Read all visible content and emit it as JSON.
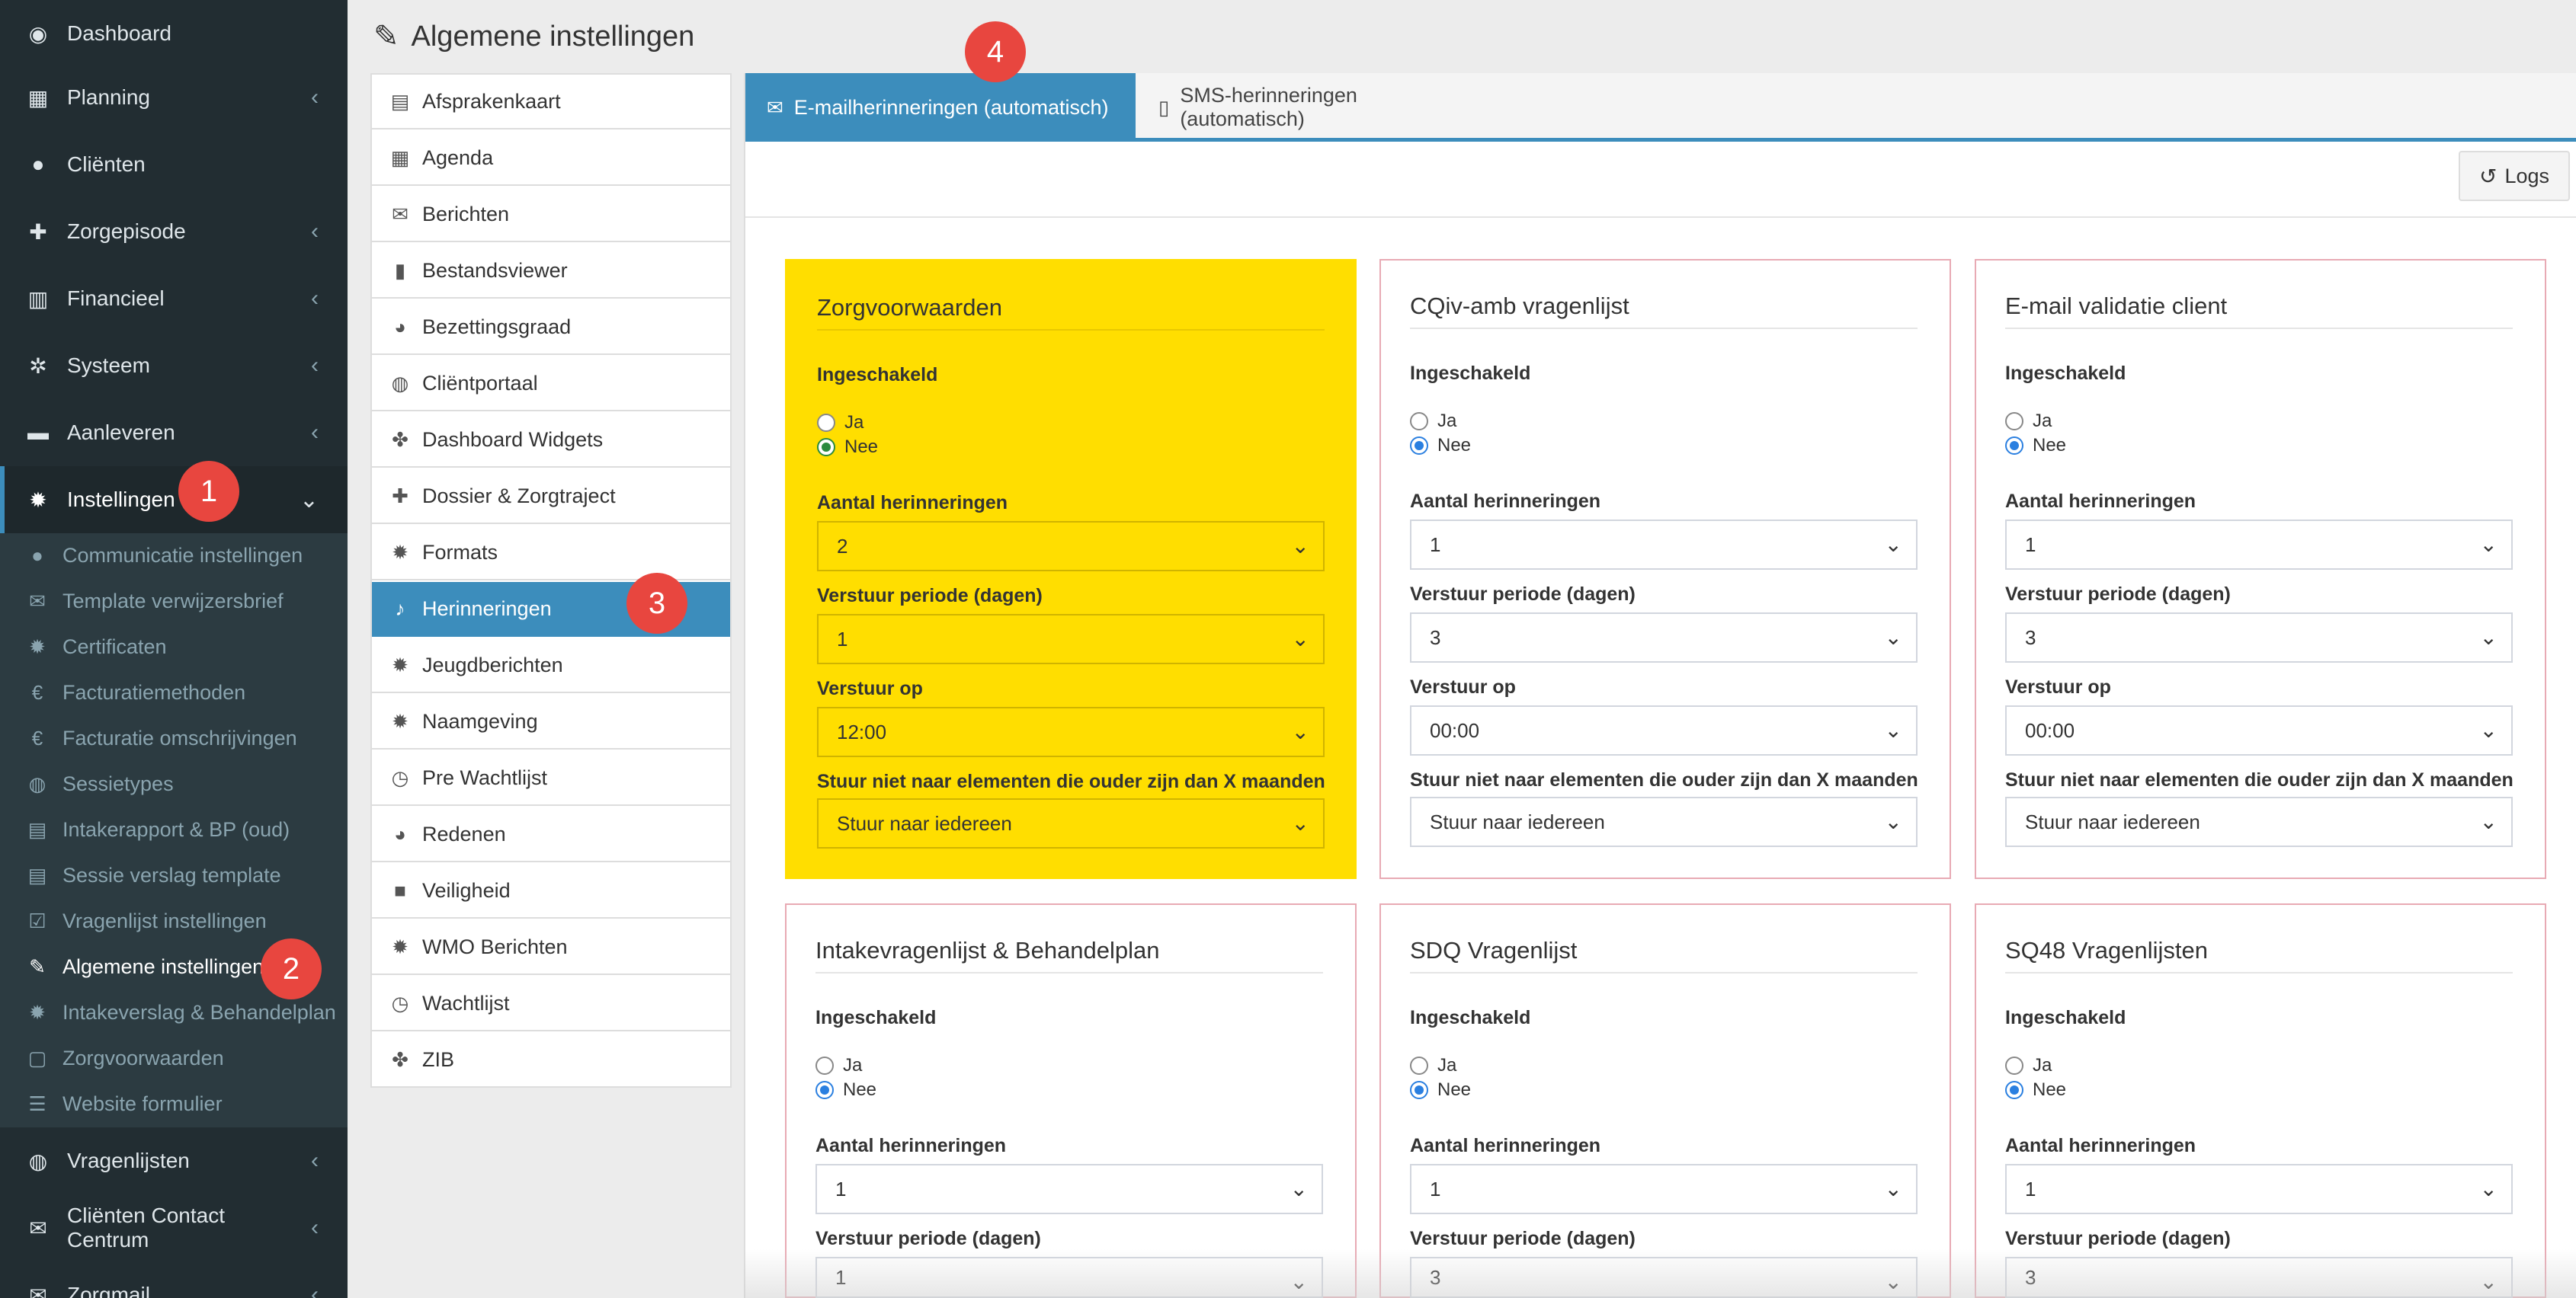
{
  "sidebar": {
    "items": [
      {
        "label": "Dashboard",
        "icon": "dashboard-icon",
        "glyph": "◉",
        "chevron": false
      },
      {
        "label": "Planning",
        "icon": "calendar-icon",
        "glyph": "▦",
        "chevron": true
      },
      {
        "label": "Cliënten",
        "icon": "user-icon",
        "glyph": "●",
        "chevron": false
      },
      {
        "label": "Zorgepisode",
        "icon": "medkit-icon",
        "glyph": "✚",
        "chevron": true
      },
      {
        "label": "Financieel",
        "icon": "book-icon",
        "glyph": "▥",
        "chevron": true
      },
      {
        "label": "Systeem",
        "icon": "cogs-icon",
        "glyph": "✲",
        "chevron": true
      },
      {
        "label": "Aanleveren",
        "icon": "truck-icon",
        "glyph": "▬",
        "chevron": true
      },
      {
        "label": "Instellingen",
        "icon": "gear-icon",
        "glyph": "✹",
        "chevron": true,
        "active": true
      }
    ],
    "subitems": [
      {
        "label": "Communicatie instellingen",
        "icon": "comments-icon",
        "glyph": "●"
      },
      {
        "label": "Template verwijzersbrief",
        "icon": "envelope-icon",
        "glyph": "✉"
      },
      {
        "label": "Certificaten",
        "icon": "certificate-icon",
        "glyph": "✹"
      },
      {
        "label": "Facturatiemethoden",
        "icon": "euro-icon",
        "glyph": "€"
      },
      {
        "label": "Facturatie omschrijvingen",
        "icon": "euro-icon",
        "glyph": "€"
      },
      {
        "label": "Sessietypes",
        "icon": "globe-icon",
        "glyph": "◍"
      },
      {
        "label": "Intakerapport & BP (oud)",
        "icon": "file-text-icon",
        "glyph": "▤"
      },
      {
        "label": "Sessie verslag template",
        "icon": "file-text-icon",
        "glyph": "▤"
      },
      {
        "label": "Vragenlijst instellingen",
        "icon": "check-square-icon",
        "glyph": "☑"
      },
      {
        "label": "Algemene instellingen",
        "icon": "wrench-icon",
        "glyph": "✎",
        "current": true
      },
      {
        "label": "Intakeverslag & Behandelplan",
        "icon": "gear-icon",
        "glyph": "✹"
      },
      {
        "label": "Zorgvoorwaarden",
        "icon": "file-pdf-icon",
        "glyph": "▢"
      },
      {
        "label": "Website formulier",
        "icon": "list-icon",
        "glyph": "☰"
      }
    ],
    "bottom_items": [
      {
        "label": "Vragenlijsten",
        "icon": "globe-icon",
        "glyph": "◍",
        "chevron": true
      },
      {
        "label": "Cliënten Contact Centrum",
        "icon": "envelope-icon",
        "glyph": "✉",
        "chevron": true
      },
      {
        "label": "Zorgmail",
        "icon": "envelope-icon",
        "glyph": "✉",
        "chevron": true
      }
    ]
  },
  "header": {
    "title": "Algemene instellingen",
    "icon": "wrench-icon",
    "glyph": "✎"
  },
  "settings_menu": {
    "items": [
      {
        "label": "Afsprakenkaart",
        "icon": "list-alt-icon",
        "glyph": "▤"
      },
      {
        "label": "Agenda",
        "icon": "calendar-icon",
        "glyph": "▦"
      },
      {
        "label": "Berichten",
        "icon": "envelope-icon",
        "glyph": "✉"
      },
      {
        "label": "Bestandsviewer",
        "icon": "file-icon",
        "glyph": "▮"
      },
      {
        "label": "Bezettingsgraad",
        "icon": "pie-chart-icon",
        "glyph": "◕"
      },
      {
        "label": "Cliëntportaal",
        "icon": "globe-icon",
        "glyph": "◍"
      },
      {
        "label": "Dashboard Widgets",
        "icon": "puzzle-icon",
        "glyph": "✤"
      },
      {
        "label": "Dossier & Zorgtraject",
        "icon": "medkit-icon",
        "glyph": "✚"
      },
      {
        "label": "Formats",
        "icon": "gear-icon",
        "glyph": "✹"
      },
      {
        "label": "Herinneringen",
        "icon": "bell-icon",
        "glyph": "♪",
        "active": true
      },
      {
        "label": "Jeugdberichten",
        "icon": "gear-icon",
        "glyph": "✹"
      },
      {
        "label": "Naamgeving",
        "icon": "gear-icon",
        "glyph": "✹"
      },
      {
        "label": "Pre Wachtlijst",
        "icon": "clock-icon",
        "glyph": "◷"
      },
      {
        "label": "Redenen",
        "icon": "pie-chart-icon",
        "glyph": "◕"
      },
      {
        "label": "Veiligheid",
        "icon": "lock-icon",
        "glyph": "■"
      },
      {
        "label": "WMO Berichten",
        "icon": "gear-icon",
        "glyph": "✹"
      },
      {
        "label": "Wachtlijst",
        "icon": "clock-icon",
        "glyph": "◷"
      },
      {
        "label": "ZIB",
        "icon": "puzzle-icon",
        "glyph": "✤"
      }
    ]
  },
  "tabs": [
    {
      "label": "E-mailherinneringen (automatisch)",
      "icon": "envelope-icon",
      "glyph": "✉",
      "active": true
    },
    {
      "label": "SMS-herinneringen (automatisch)",
      "icon": "mobile-icon",
      "glyph": "▯",
      "active": false
    }
  ],
  "logs_button": {
    "label": "Logs",
    "icon": "history-icon",
    "glyph": "↺"
  },
  "form_labels": {
    "enabled": "Ingeschakeld",
    "yes": "Ja",
    "no": "Nee",
    "count": "Aantal herinneringen",
    "period": "Verstuur periode (dagen)",
    "send_at": "Verstuur op",
    "age_filter": "Stuur niet naar elementen die ouder zijn dan X maanden"
  },
  "cards": [
    {
      "title": "Zorgvoorwaarden",
      "highlight": true,
      "enabled": false,
      "count": "2",
      "period": "1",
      "send_at": "12:00",
      "age_filter": "Stuur naar iedereen"
    },
    {
      "title": "CQiv-amb vragenlijst",
      "highlight": false,
      "enabled": false,
      "count": "1",
      "period": "3",
      "send_at": "00:00",
      "age_filter": "Stuur naar iedereen"
    },
    {
      "title": "E-mail validatie client",
      "highlight": false,
      "enabled": false,
      "count": "1",
      "period": "3",
      "send_at": "00:00",
      "age_filter": "Stuur naar iedereen"
    },
    {
      "title": "Intakevragenlijst & Behandelplan",
      "highlight": false,
      "enabled": false,
      "count": "1",
      "period": "1"
    },
    {
      "title": "SDQ Vragenlijst",
      "highlight": false,
      "enabled": false,
      "count": "1",
      "period": "3"
    },
    {
      "title": "SQ48 Vragenlijsten",
      "highlight": false,
      "enabled": false,
      "count": "1",
      "period": "3"
    }
  ],
  "badges": [
    "1",
    "2",
    "3",
    "4"
  ],
  "colors": {
    "sidebar_bg": "#222d32",
    "accent": "#3c8dbc",
    "highlight": "#ffde00",
    "badge": "#e8463f",
    "card_border": "#e8aab4"
  }
}
